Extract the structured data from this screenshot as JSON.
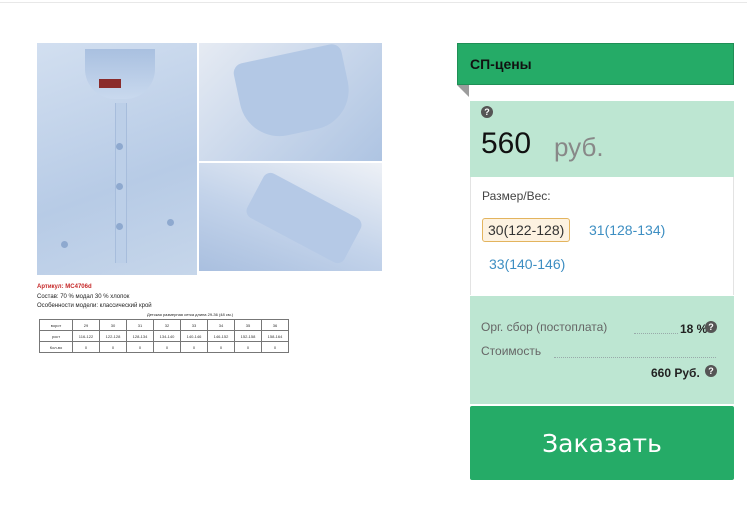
{
  "product": {
    "caption": {
      "article": "Артикул: МС4706d",
      "composition": "Состав: 70 % модал 30 % хлопок",
      "features": "Особенности модели: классический крой",
      "table_title": "Детская размерная сетка длина 29-36 (48 см.)"
    },
    "size_table": {
      "rows": [
        {
          "label": "ворот",
          "cells": [
            "29",
            "30",
            "31",
            "32",
            "33",
            "34",
            "35",
            "36"
          ]
        },
        {
          "label": "рост",
          "cells": [
            "116-122",
            "122-128",
            "128-134",
            "134-140",
            "140-146",
            "146-152",
            "152-158",
            "158-164"
          ]
        },
        {
          "label": "Кол-во",
          "cells": [
            "0",
            "0",
            "0",
            "0",
            "0",
            "0",
            "0",
            "0"
          ]
        }
      ]
    }
  },
  "card": {
    "header": "СП-цены",
    "help_glyph": "?",
    "price": {
      "amount": "560",
      "currency": "руб."
    },
    "size_label": "Размер/Вес:",
    "sizes": [
      {
        "label": "30(122-128)",
        "selected": true
      },
      {
        "label": "31(128-134)",
        "selected": false
      },
      {
        "label": "33(140-146)",
        "selected": false
      }
    ],
    "summary": {
      "fee_label": "Орг. сбор (постоплата)",
      "fee_value": "18 %",
      "cost_label": "Стоимость",
      "cost_value": "660 Руб."
    },
    "order_button": "Заказать"
  },
  "colors": {
    "accent_green": "#25ab67",
    "light_green": "#bde6d2",
    "link_blue": "#3d8ec2",
    "selected_border": "#e3b45e"
  }
}
